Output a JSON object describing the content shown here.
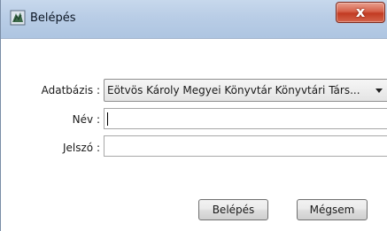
{
  "window": {
    "title": "Belépés",
    "close_label": "x"
  },
  "form": {
    "database": {
      "label": "Adatbázis :",
      "selected": "Eötvös Károly Megyei Könyvtár Könyvtári Társ..."
    },
    "username": {
      "label": "Név :",
      "value": ""
    },
    "password": {
      "label": "Jelszó :",
      "value": ""
    }
  },
  "buttons": {
    "login": "Belépés",
    "cancel": "Mégsem"
  },
  "colors": {
    "titlebar": "#b9cde6",
    "close_button": "#c23b22"
  },
  "icons": {
    "app": "app-icon",
    "close": "close-icon",
    "dropdown": "chevron-down-icon"
  }
}
